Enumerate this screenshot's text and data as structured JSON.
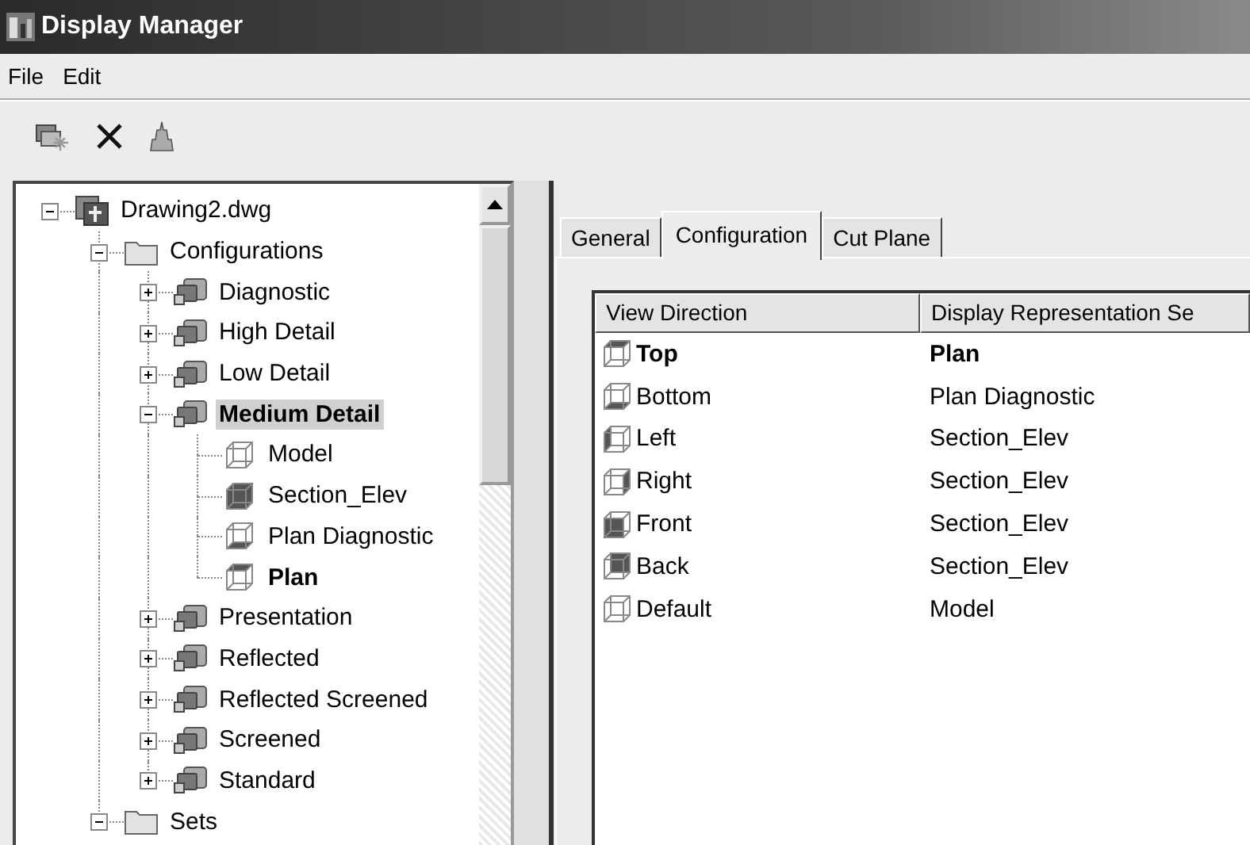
{
  "window": {
    "title": "Display Manager"
  },
  "menu": [
    "File",
    "Edit"
  ],
  "tree": [
    {
      "label": "Drawing2.dwg",
      "kind": "drawing",
      "expanded": true,
      "selected": false,
      "current": false,
      "children": [
        {
          "label": "Configurations",
          "kind": "folder",
          "expanded": true,
          "selected": false,
          "current": false,
          "children": [
            {
              "label": "Diagnostic",
              "kind": "configuration",
              "expanded": false,
              "selected": false,
              "current": false
            },
            {
              "label": "High Detail",
              "kind": "configuration",
              "expanded": false,
              "selected": false,
              "current": false
            },
            {
              "label": "Low Detail",
              "kind": "configuration",
              "expanded": false,
              "selected": false,
              "current": false
            },
            {
              "label": "Medium Detail",
              "kind": "configuration",
              "expanded": true,
              "selected": true,
              "current": false,
              "children": [
                {
                  "label": "Model",
                  "kind": "open-cube",
                  "selected": false,
                  "current": false
                },
                {
                  "label": "Section_Elev",
                  "kind": "solid-cube",
                  "selected": false,
                  "current": false
                },
                {
                  "label": "Plan Diagnostic",
                  "kind": "bottom-cube",
                  "selected": false,
                  "current": false
                },
                {
                  "label": "Plan",
                  "kind": "top-cube",
                  "selected": false,
                  "current": true
                }
              ]
            },
            {
              "label": "Presentation",
              "kind": "configuration",
              "expanded": false,
              "selected": false,
              "current": false
            },
            {
              "label": "Reflected",
              "kind": "configuration",
              "expanded": false,
              "selected": false,
              "current": false
            },
            {
              "label": "Reflected Screened",
              "kind": "configuration",
              "expanded": false,
              "selected": false,
              "current": false
            },
            {
              "label": "Screened",
              "kind": "configuration",
              "expanded": false,
              "selected": false,
              "current": false
            },
            {
              "label": "Standard",
              "kind": "configuration",
              "expanded": false,
              "selected": false,
              "current": false
            }
          ]
        },
        {
          "label": "Sets",
          "kind": "folder",
          "expanded": true,
          "selected": false,
          "current": false
        }
      ]
    }
  ],
  "tabs": [
    {
      "label": "General",
      "selected": false
    },
    {
      "label": "Configuration",
      "selected": true
    },
    {
      "label": "Cut Plane",
      "selected": false
    }
  ],
  "table": {
    "columns": [
      "View Direction",
      "Display Representation Se"
    ],
    "rows": [
      {
        "direction": "Top",
        "kind": "top",
        "set": "Plan",
        "current": true
      },
      {
        "direction": "Bottom",
        "kind": "bottom",
        "set": "Plan Diagnostic",
        "current": false
      },
      {
        "direction": "Left",
        "kind": "left",
        "set": "Section_Elev",
        "current": false
      },
      {
        "direction": "Right",
        "kind": "right",
        "set": "Section_Elev",
        "current": false
      },
      {
        "direction": "Front",
        "kind": "front",
        "set": "Section_Elev",
        "current": false
      },
      {
        "direction": "Back",
        "kind": "back",
        "set": "Section_Elev",
        "current": false
      },
      {
        "direction": "Default",
        "kind": "none",
        "set": "Model",
        "current": false
      }
    ]
  }
}
